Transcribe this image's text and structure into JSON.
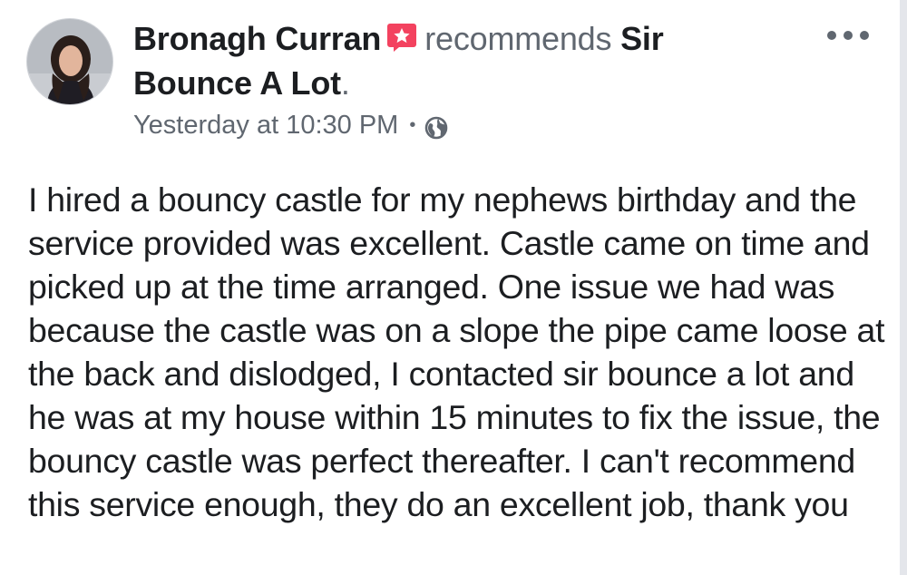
{
  "post": {
    "author_name": "Bronagh Curran",
    "action_verb": "recommends",
    "page_name": "Sir Bounce A Lot",
    "page_name_suffix": ".",
    "timestamp": "Yesterday at 10:30 PM",
    "separator": "•",
    "privacy_icon": "globe-icon",
    "badge_icon": "recommendation-star-icon",
    "more_icon": "more-options-icon",
    "body": "I hired a bouncy castle for my nephews birthday and the service provided was excellent. Castle came on time and picked up at the time arranged. One issue we had was because the castle was on a slope the pipe came loose at the back and dislodged, I contacted sir bounce a lot and he was at my house within 15 minutes to fix the issue, the bouncy castle was perfect thereafter. I can't recommend this service enough, they do an excellent job, thank you"
  },
  "colors": {
    "badge": "#f3425f",
    "primary_text": "#1c1e21",
    "secondary_text": "#606770"
  }
}
